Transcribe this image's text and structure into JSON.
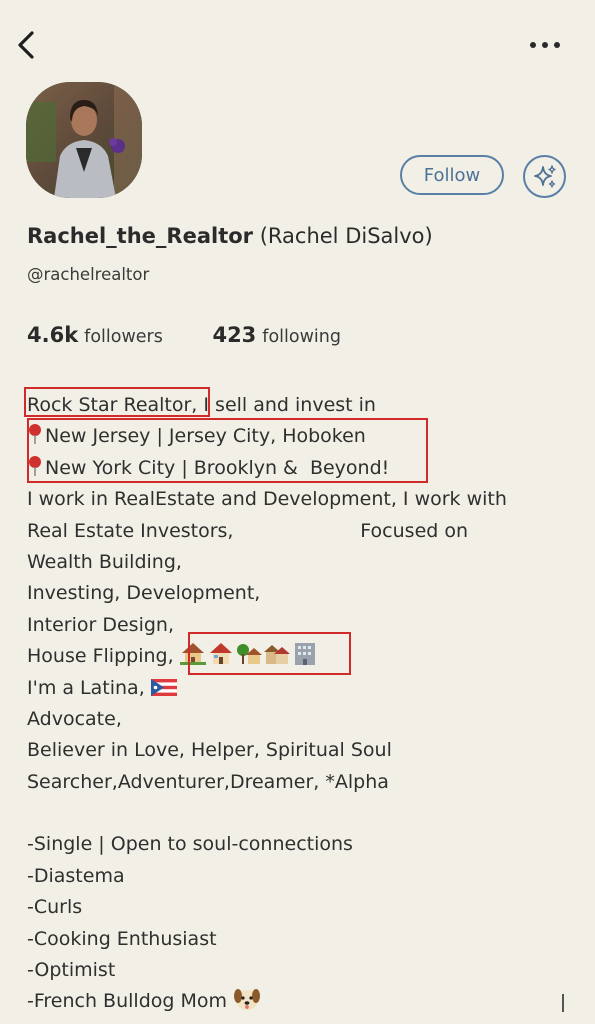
{
  "profile": {
    "username": "Rachel_the_Realtor",
    "full_name": "(Rachel DiSalvo)",
    "handle": "@rachelrealtor",
    "followers_count": "4.6k",
    "followers_label": "followers",
    "following_count": "423",
    "following_label": "following"
  },
  "actions": {
    "follow_label": "Follow"
  },
  "icons": {
    "back": "chevron-left-icon",
    "more": "more-horizontal-icon",
    "sparkle": "sparkle-icon"
  },
  "colors": {
    "background": "#f2f0e6",
    "accent": "#5a7fa6",
    "highlight": "#d12a2a"
  },
  "bio": {
    "line1_a": "Rock Star Realtor,",
    "line1_b": " I sell and invest in",
    "line2": "New Jersey | Jersey City, Hoboken",
    "line3": "New York City | Brooklyn &  Beyond!",
    "line4": "I work in RealEstate and Development, I work with",
    "line5": "Real Estate Investors,                     Focused on",
    "line6": "Wealth Building,",
    "line7": "Investing, Development,",
    "line8": "Interior Design,",
    "line9": "House Flipping, ",
    "line10": "I'm a Latina, ",
    "line11": "Advocate,",
    "line12": "Believer in Love, Helper, Spiritual Soul",
    "line13": "Searcher,Adventurer,Dreamer, *Alpha",
    "line14": "",
    "line15": "-Single | Open to soul-connections",
    "line16": "-Diastema",
    "line17": "-Curls",
    "line18": "-Cooking Enthusiast",
    "line19": "-Optimist",
    "line20": "-French Bulldog Mom "
  }
}
